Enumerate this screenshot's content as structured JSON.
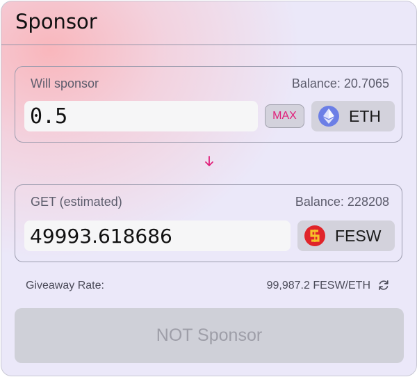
{
  "header": {
    "title": "Sponsor"
  },
  "sponsor_panel": {
    "label": "Will sponsor",
    "balance": "Balance: 20.7065",
    "amount": "0.5",
    "max_label": "MAX",
    "token": "ETH",
    "token_icon": "ethereum-icon"
  },
  "arrow_icon": "arrow-down-icon",
  "receive_panel": {
    "label": "GET (estimated)",
    "balance": "Balance: 228208",
    "amount": "49993.618686",
    "token": "FESW",
    "token_icon": "fesw-token-icon"
  },
  "rate": {
    "label": "Giveaway Rate:",
    "value": "99,987.2 FESW/ETH",
    "icon": "refresh-icon"
  },
  "submit": {
    "label": "NOT Sponsor"
  },
  "colors": {
    "accent": "#e0207a",
    "eth": "#6c7fe6",
    "fesw": "#e0242a",
    "button_disabled_bg": "#cfd0d8"
  }
}
